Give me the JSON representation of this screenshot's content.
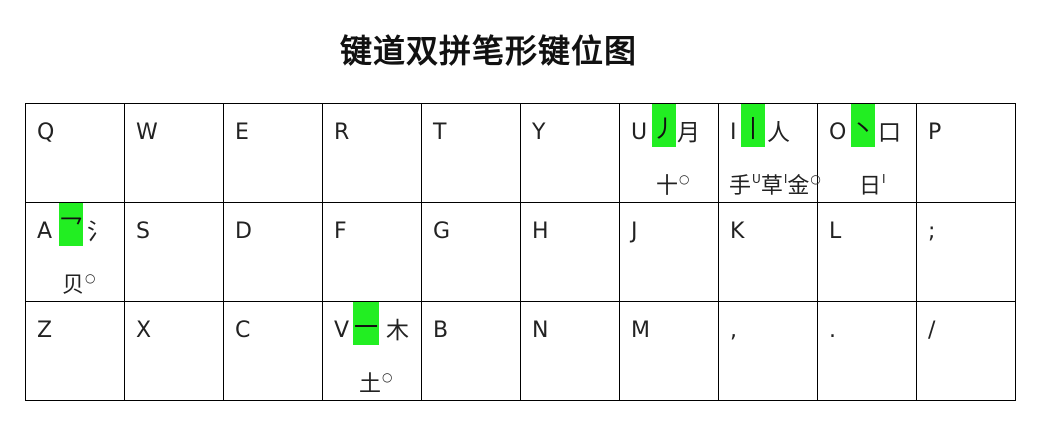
{
  "title": "键道双拼笔形键位图",
  "colors": {
    "highlight": "#22ee22",
    "border": "#000000",
    "text": "#111111"
  },
  "rows": [
    [
      {
        "key": "Q"
      },
      {
        "key": "W"
      },
      {
        "key": "E"
      },
      {
        "key": "R"
      },
      {
        "key": "T"
      },
      {
        "key": "Y"
      },
      {
        "key": "U",
        "stroke": "丿",
        "line1": "月",
        "line2": "十",
        "line2_mark": "○"
      },
      {
        "key": "I",
        "stroke": "丨",
        "line1": "人",
        "line2": "手",
        "line2_mark_a": "U",
        "line2_b": "草",
        "line2_mark_b": "I",
        "line2_c": "金",
        "line2_mark_c": "○"
      },
      {
        "key": "O",
        "stroke": "丶",
        "line1": "口",
        "line2": "日",
        "line2_mark": "I"
      },
      {
        "key": "P"
      }
    ],
    [
      {
        "key": "A",
        "stroke": "乛",
        "line1": "氵",
        "line2": "贝",
        "line2_mark": "○"
      },
      {
        "key": "S"
      },
      {
        "key": "D"
      },
      {
        "key": "F"
      },
      {
        "key": "G"
      },
      {
        "key": "H"
      },
      {
        "key": "J"
      },
      {
        "key": "K"
      },
      {
        "key": "L"
      },
      {
        "key": ";"
      }
    ],
    [
      {
        "key": "Z"
      },
      {
        "key": "X"
      },
      {
        "key": "C"
      },
      {
        "key": "V",
        "stroke": "一",
        "line1": "木",
        "line2": "土",
        "line2_mark": "○"
      },
      {
        "key": "B"
      },
      {
        "key": "N"
      },
      {
        "key": "M"
      },
      {
        "key": ","
      },
      {
        "key": "."
      },
      {
        "key": "/"
      }
    ]
  ]
}
